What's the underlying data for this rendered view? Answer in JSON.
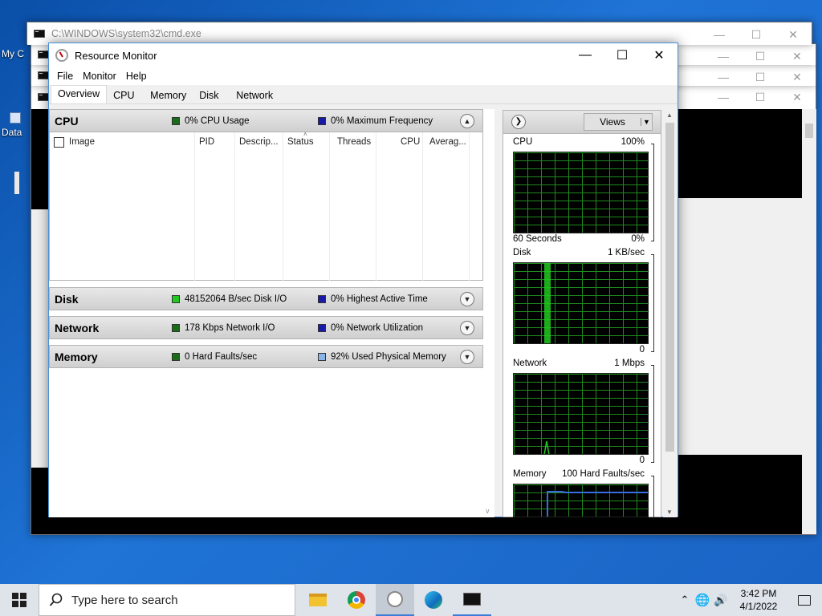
{
  "desktop": {
    "icon1_label": "My C",
    "icon2_label": "Data"
  },
  "cmd_window": {
    "title": "C:\\WINDOWS\\system32\\cmd.exe"
  },
  "resource_monitor": {
    "title": "Resource Monitor",
    "menu": [
      "File",
      "Monitor",
      "Help"
    ],
    "tabs": [
      "Overview",
      "CPU",
      "Memory",
      "Disk",
      "Network"
    ],
    "active_tab": "Overview",
    "cpu_panel": {
      "name": "CPU",
      "legend1": "0% CPU Usage",
      "legend2": "0% Maximum Frequency",
      "columns": [
        "Image",
        "PID",
        "Descrip...",
        "Status",
        "Threads",
        "CPU",
        "Averag..."
      ]
    },
    "disk_panel": {
      "name": "Disk",
      "legend1": "48152064 B/sec Disk I/O",
      "legend2": "0% Highest Active Time"
    },
    "network_panel": {
      "name": "Network",
      "legend1": "178 Kbps Network I/O",
      "legend2": "0% Network Utilization"
    },
    "memory_panel": {
      "name": "Memory",
      "legend1": "0 Hard Faults/sec",
      "legend2": "92% Used Physical Memory"
    },
    "views_label": "Views",
    "graphs": {
      "cpu": {
        "label": "CPU",
        "max": "100%",
        "time": "60 Seconds",
        "min": "0%"
      },
      "disk": {
        "label": "Disk",
        "max": "1 KB/sec",
        "min": "0"
      },
      "network": {
        "label": "Network",
        "max": "1 Mbps",
        "min": "0"
      },
      "memory": {
        "label": "Memory",
        "max": "100 Hard Faults/sec"
      }
    },
    "colors": {
      "green": "#22c822",
      "dark_green": "#1a6b1a",
      "blue": "#1a1aa8",
      "light_blue": "#8ab4e8"
    }
  },
  "taskbar": {
    "search_placeholder": "Type here to search",
    "time": "3:42 PM",
    "date": "4/1/2022"
  }
}
